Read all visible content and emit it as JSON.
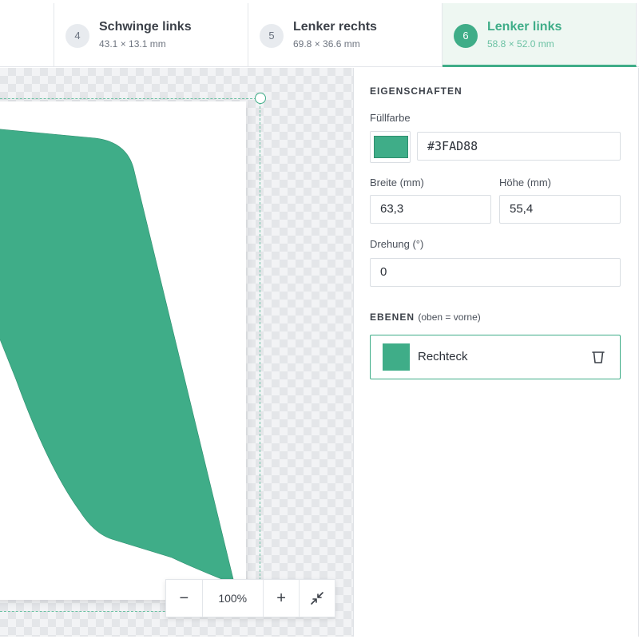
{
  "tabs": [
    {
      "num": "4",
      "title": "Schwinge links",
      "dims": "43.1 × 13.1 mm",
      "active": false
    },
    {
      "num": "5",
      "title": "Lenker rechts",
      "dims": "69.8 × 36.6 mm",
      "active": false
    },
    {
      "num": "6",
      "title": "Lenker links",
      "dims": "58.8 × 52.0 mm",
      "active": true
    }
  ],
  "canvas": {
    "shape_color": "#3FAD88"
  },
  "zoom": {
    "minus": "−",
    "value": "100%",
    "plus": "+",
    "fit_icon": "collapse-arrows-icon"
  },
  "properties": {
    "title": "EIGENSCHAFTEN",
    "fill_label": "Füllfarbe",
    "fill_value": "#3FAD88",
    "width_label": "Breite (mm)",
    "width_value": "63,3",
    "height_label": "Höhe (mm)",
    "height_value": "55,4",
    "rotation_label": "Drehung (°)",
    "rotation_value": "0"
  },
  "layers": {
    "title": "EBENEN",
    "subtitle": "(oben = vorne)",
    "items": [
      {
        "name": "Rechteck",
        "color": "#3FAD88",
        "icon": "trash-icon"
      }
    ]
  }
}
